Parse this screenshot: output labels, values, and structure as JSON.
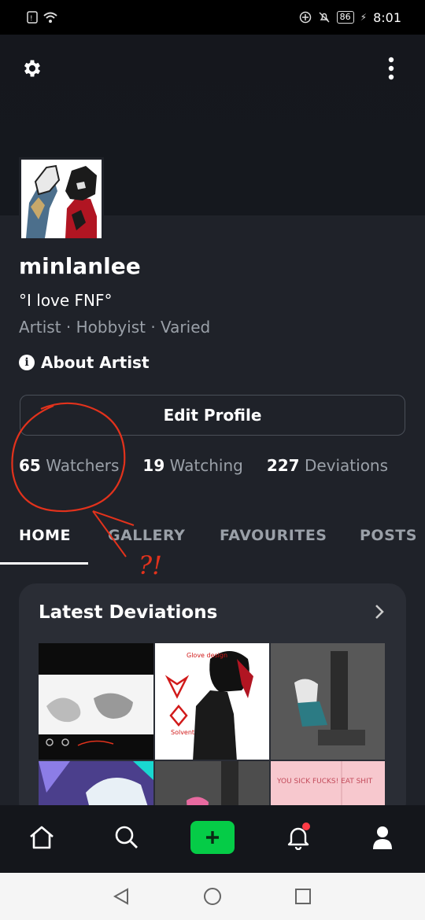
{
  "status_bar": {
    "time": "8:01",
    "battery": "86"
  },
  "profile": {
    "username": "minlanlee",
    "tagline": "°I love FNF°",
    "meta": "Artist · Hobbyist · Varied",
    "about_label": "About Artist",
    "edit_label": "Edit Profile"
  },
  "stats": [
    {
      "count": "65",
      "label": "Watchers"
    },
    {
      "count": "19",
      "label": "Watching"
    },
    {
      "count": "227",
      "label": "Deviations"
    }
  ],
  "tabs": [
    "HOME",
    "GALLERY",
    "FAVOURITES",
    "POSTS"
  ],
  "latest": {
    "title": "Latest Deviations"
  },
  "thumb_texts": {
    "t1_caption": "Glove design",
    "t1_label": "Solvent",
    "t5_text": "YOU SICK FUCKS! EAT SHIT"
  },
  "annotation": {
    "marks": "?!"
  },
  "colors": {
    "accent": "#05cc47",
    "notification": "#ff3b46",
    "annotation": "#e2321c"
  },
  "icons": [
    "gear-icon",
    "more-vertical-icon",
    "info-icon",
    "chevron-right-icon",
    "home-icon",
    "search-icon",
    "plus-icon",
    "bell-icon",
    "user-icon",
    "back-icon",
    "home-circle-icon",
    "recents-icon"
  ]
}
